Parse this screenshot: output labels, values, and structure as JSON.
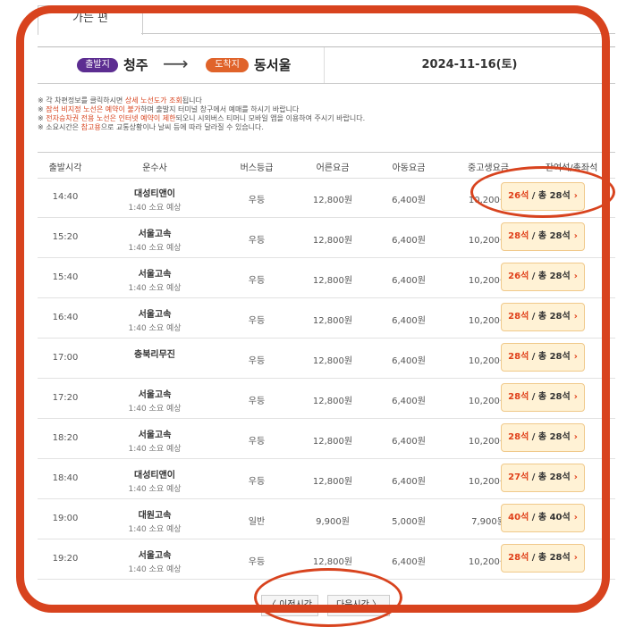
{
  "tab": {
    "label": "가는 편"
  },
  "route": {
    "dep_badge": "출발지",
    "dep_city": "청주",
    "arrow": "⟶",
    "arr_badge": "도착지",
    "arr_city": "동서울",
    "date": "2024-11-16(토)"
  },
  "notes": [
    {
      "prefix": "※ 각 차편정보를 클릭하시면 ",
      "red": "상세 노선도가 조회",
      "suffix": "됩니다"
    },
    {
      "prefix": "※ ",
      "red": "잠석 비지정 노선은 예약이 불가",
      "suffix": "하며 출발지 터미널 창구에서 예매를 하시기 바랍니다"
    },
    {
      "prefix": "※ ",
      "red": "전자승차권 전용 노선은 인터넷 예약이 제한",
      "suffix": "되오니 시외버스 티머니 모바일 앱을 이용하여 주시기 바랍니다."
    },
    {
      "prefix": "※ 소요시간은 ",
      "red": "참고용",
      "suffix": "으로 교통상황이나 날씨 등에 따라 달라질 수 있습니다."
    }
  ],
  "table": {
    "headers": [
      "출발시각",
      "운수사",
      "버스등급",
      "어른요금",
      "아동요금",
      "중고생요금",
      "잔여석/총좌석"
    ],
    "rows": [
      {
        "time": "14:40",
        "company": "대성티앤이",
        "duration": "1:40 소요 예상",
        "grade": "우등",
        "adult": "12,800원",
        "child": "6,400원",
        "student": "10,200원",
        "remain": "26석",
        "total": " / 총 28석"
      },
      {
        "time": "15:20",
        "company": "서울고속",
        "duration": "1:40 소요 예상",
        "grade": "우등",
        "adult": "12,800원",
        "child": "6,400원",
        "student": "10,200원",
        "remain": "28석",
        "total": " / 총 28석"
      },
      {
        "time": "15:40",
        "company": "서울고속",
        "duration": "1:40 소요 예상",
        "grade": "우등",
        "adult": "12,800원",
        "child": "6,400원",
        "student": "10,200원",
        "remain": "26석",
        "total": " / 총 28석"
      },
      {
        "time": "16:40",
        "company": "서울고속",
        "duration": "1:40 소요 예상",
        "grade": "우등",
        "adult": "12,800원",
        "child": "6,400원",
        "student": "10,200원",
        "remain": "28석",
        "total": " / 총 28석"
      },
      {
        "time": "17:00",
        "company": "충북리무진",
        "duration": "",
        "grade": "우등",
        "adult": "12,800원",
        "child": "6,400원",
        "student": "10,200원",
        "remain": "28석",
        "total": " / 총 28석"
      },
      {
        "time": "17:20",
        "company": "서울고속",
        "duration": "1:40 소요 예상",
        "grade": "우등",
        "adult": "12,800원",
        "child": "6,400원",
        "student": "10,200원",
        "remain": "28석",
        "total": " / 총 28석"
      },
      {
        "time": "18:20",
        "company": "서울고속",
        "duration": "1:40 소요 예상",
        "grade": "우등",
        "adult": "12,800원",
        "child": "6,400원",
        "student": "10,200원",
        "remain": "28석",
        "total": " / 총 28석"
      },
      {
        "time": "18:40",
        "company": "대성티앤이",
        "duration": "1:40 소요 예상",
        "grade": "우등",
        "adult": "12,800원",
        "child": "6,400원",
        "student": "10,200원",
        "remain": "27석",
        "total": " / 총 28석"
      },
      {
        "time": "19:00",
        "company": "대원고속",
        "duration": "1:40 소요 예상",
        "grade": "일반",
        "adult": "9,900원",
        "child": "5,000원",
        "student": "7,900원",
        "remain": "40석",
        "total": " / 총 40석"
      },
      {
        "time": "19:20",
        "company": "서울고속",
        "duration": "1:40 소요 예상",
        "grade": "우등",
        "adult": "12,800원",
        "child": "6,400원",
        "student": "10,200원",
        "remain": "28석",
        "total": " / 총 28석"
      }
    ]
  },
  "pagination": {
    "prev": "〈 이전시간",
    "next": "다음시간 〉"
  },
  "icons": {
    "seat_chevron": "›"
  },
  "colors": {
    "accent": "#d8431e",
    "departure_badge": "#5c2d91",
    "arrival_badge": "#e0632a",
    "seat_bg": "#fff2d5"
  }
}
